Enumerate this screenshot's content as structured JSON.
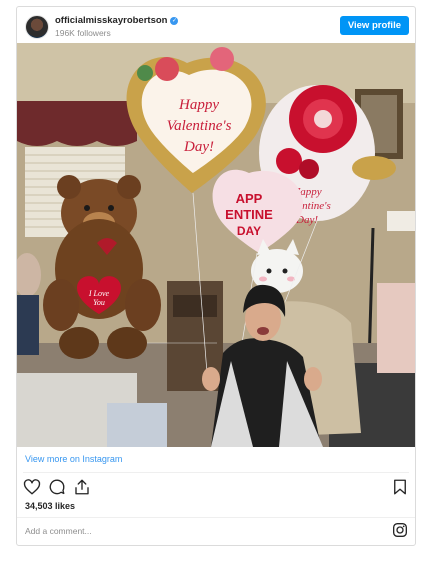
{
  "post": {
    "username": "officialmisskayrobertson",
    "followers": "196K followers",
    "view_profile_label": "View profile",
    "view_more_label": "View more on Instagram",
    "likes": "34,503 likes",
    "comment_placeholder": "Add a comment..."
  },
  "photo_text": {
    "heart_balloon": [
      "Happy",
      "Valentine's",
      "Day!"
    ],
    "red_balloon": [
      "Happy",
      "Valentine's",
      "Day!"
    ],
    "small_balloon": [
      "APP",
      "ENTINE",
      "DAY"
    ],
    "bear_heart": [
      "I Love",
      "You"
    ]
  },
  "colors": {
    "accent": "#0095f6",
    "link": "#3897f0",
    "verified": "#3897f0",
    "muted_text": "#8e8e8e"
  },
  "icons": [
    "verified-badge-icon",
    "heart-icon",
    "comment-icon",
    "share-icon",
    "bookmark-icon",
    "instagram-icon"
  ]
}
